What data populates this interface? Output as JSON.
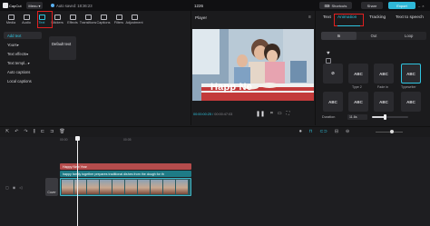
{
  "titlebar": {
    "logo": "CapCut",
    "menu": "Menu",
    "autosave": "Auto saved: 18:36:23",
    "project": "1226",
    "shortcuts": "Shortcuts",
    "share": "Share",
    "export": "Export"
  },
  "toolbar": {
    "items": [
      {
        "label": "Media",
        "icon": "media-icon"
      },
      {
        "label": "Audio",
        "icon": "audio-icon"
      },
      {
        "label": "Text",
        "icon": "text-icon"
      },
      {
        "label": "Stickers",
        "icon": "stickers-icon"
      },
      {
        "label": "Effects",
        "icon": "effects-icon"
      },
      {
        "label": "Transitions",
        "icon": "transitions-icon"
      },
      {
        "label": "Captions",
        "icon": "captions-icon"
      },
      {
        "label": "Filters",
        "icon": "filters-icon"
      },
      {
        "label": "Adjustment",
        "icon": "adjustment-icon"
      }
    ],
    "active_index": 2
  },
  "leftnav": {
    "items": [
      "Add text",
      "Yours",
      "Text effects",
      "Text templ...",
      "Auto captions",
      "Local captions"
    ],
    "selected_index": 0,
    "default_text": "Default text"
  },
  "player": {
    "title": "Player",
    "current": "00:00:00:25",
    "total": "00:00:47:03",
    "overlay_text": "Happ Ne"
  },
  "rightpanel": {
    "tabs": [
      "Text",
      "Animation",
      "Tracking",
      "Text to speech"
    ],
    "active_tab": 1,
    "segments": [
      "In",
      "Out",
      "Loop"
    ],
    "active_segment": 0,
    "presets": [
      {
        "glyph": "⊘",
        "label": ""
      },
      {
        "glyph": "ABC",
        "label": "Type 2"
      },
      {
        "glyph": "ABC",
        "label": "Fade in"
      },
      {
        "glyph": "ABC",
        "label": "Typewriter"
      },
      {
        "glyph": "ABC",
        "label": ""
      },
      {
        "glyph": "ABC",
        "label": ""
      },
      {
        "glyph": "ABC",
        "label": ""
      },
      {
        "glyph": "ABC",
        "label": ""
      }
    ],
    "duration_label": "Duration",
    "duration_value": "11.6s",
    "duration_fraction": 0.35
  },
  "timeline": {
    "ticks": [
      "00:00",
      "00:05"
    ],
    "text_clip": "Happy New Year",
    "caption_clip": "happy family together prepares traditional dishes from the dough for th",
    "cover": "Cover"
  },
  "colors": {
    "accent": "#2fc4e0",
    "export": "#2fb8d8",
    "highlight": "#e02020",
    "text_clip": "#b44c4c",
    "caption_clip": "#1e7b86"
  }
}
